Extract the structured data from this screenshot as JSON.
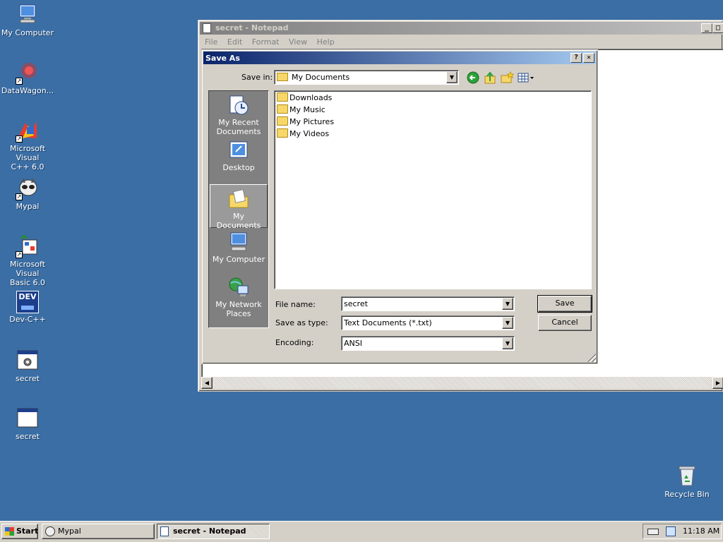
{
  "desktop": {
    "icons": [
      {
        "label": "My Computer"
      },
      {
        "label": "DataWagon..."
      },
      {
        "label_line1": "Microsoft Visual",
        "label_line2": "C++ 6.0"
      },
      {
        "label": "Mypal"
      },
      {
        "label_line1": "Microsoft Visual",
        "label_line2": "Basic 6.0"
      },
      {
        "label": "Dev-C++"
      },
      {
        "label": "secret"
      },
      {
        "label": "secret"
      },
      {
        "label": "Recycle Bin"
      }
    ],
    "devcpp_badge": "DEV"
  },
  "notepad": {
    "title": "secret - Notepad",
    "menu": [
      "File",
      "Edit",
      "Format",
      "View",
      "Help"
    ]
  },
  "dialog": {
    "title": "Save As",
    "help_glyph": "?",
    "close_glyph": "✕",
    "save_in_label": "Save in:",
    "save_in_value": "My Documents",
    "places": [
      {
        "line1": "My Recent",
        "line2": "Documents"
      },
      {
        "line1": "Desktop"
      },
      {
        "line1": "My Documents"
      },
      {
        "line1": "My Computer"
      },
      {
        "line1": "My Network",
        "line2": "Places"
      }
    ],
    "files": [
      "Downloads",
      "My Music",
      "My Pictures",
      "My Videos"
    ],
    "file_name_label": "File name:",
    "file_name_value": "secret",
    "save_type_label": "Save as type:",
    "save_type_value": "Text Documents (*.txt)",
    "encoding_label": "Encoding:",
    "encoding_value": "ANSI",
    "save_button": "Save",
    "cancel_button": "Cancel"
  },
  "taskbar": {
    "start_label": "Start",
    "tasks": [
      {
        "label": "Mypal",
        "active": false
      },
      {
        "label": "secret - Notepad",
        "active": true
      }
    ],
    "clock": "11:18 AM"
  },
  "colors": {
    "desktop": "#3a6ea5",
    "title_active": "#0a246a",
    "window_face": "#d4d0c8",
    "places_bar": "#808080"
  }
}
